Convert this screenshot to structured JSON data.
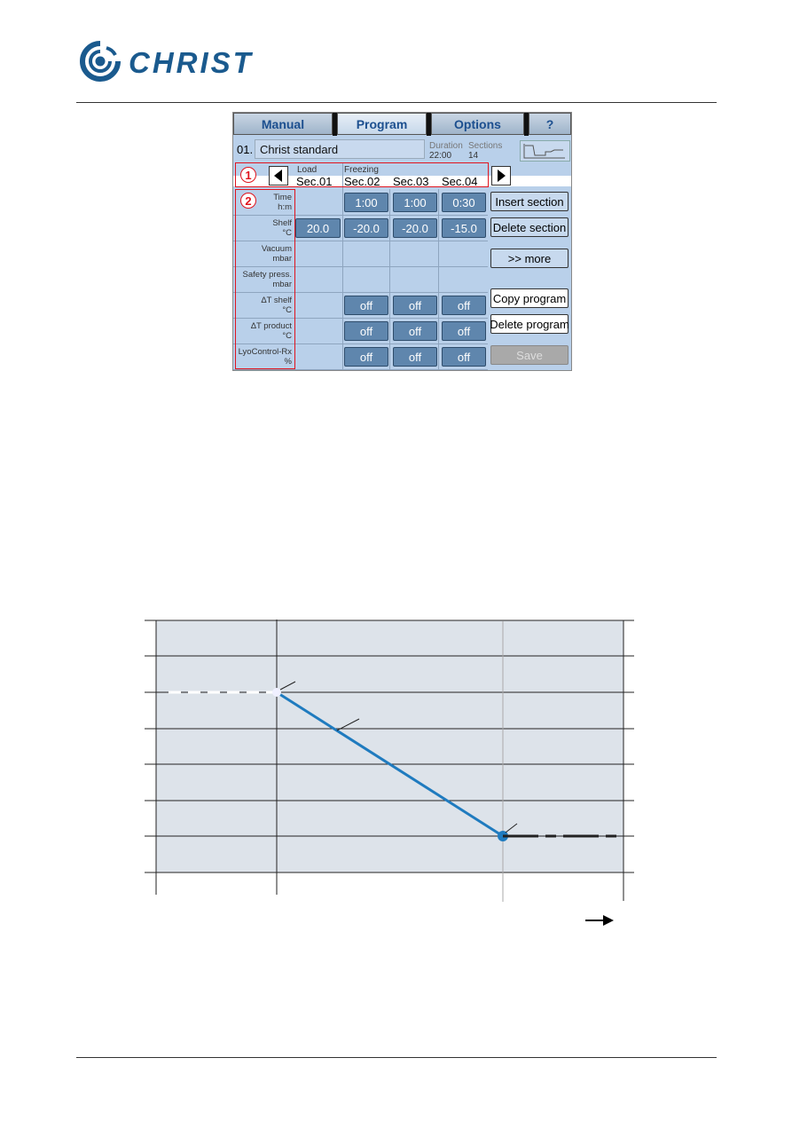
{
  "header": {
    "brand": "CHRIST",
    "brand_color": "#1a5a8e"
  },
  "ui": {
    "tabs": [
      {
        "label": "Manual"
      },
      {
        "label": "Program",
        "active": true
      },
      {
        "label": "Options"
      },
      {
        "label": "?"
      }
    ],
    "program_number": "01.",
    "program_name": "Christ standard",
    "duration_label": "Duration",
    "duration_value": "22:00",
    "sections_label": "Sections",
    "sections_value": "14",
    "callouts": [
      "1",
      "2"
    ],
    "phases": {
      "load": "Load",
      "freezing": "Freezing"
    },
    "sections": [
      "Sec.01",
      "Sec.02",
      "Sec.03",
      "Sec.04"
    ],
    "rows": [
      {
        "label": "Time",
        "unit": "h:m",
        "values": [
          "",
          "1:00",
          "1:00",
          "0:30"
        ]
      },
      {
        "label": "Shelf",
        "unit": "°C",
        "values": [
          "20.0",
          "-20.0",
          "-20.0",
          "-15.0"
        ]
      },
      {
        "label": "Vacuum",
        "unit": "mbar",
        "values": [
          "",
          "",
          "",
          ""
        ]
      },
      {
        "label": "Safety press.",
        "unit": "mbar",
        "values": [
          "",
          "",
          "",
          ""
        ]
      },
      {
        "label": "ΔT shelf",
        "unit": "°C",
        "values": [
          "",
          "off",
          "off",
          "off"
        ]
      },
      {
        "label": "ΔT product",
        "unit": "°C",
        "values": [
          "",
          "off",
          "off",
          "off"
        ]
      },
      {
        "label": "LyoControl-Rx",
        "unit": "%",
        "values": [
          "",
          "off",
          "off",
          "off"
        ]
      }
    ],
    "actions": {
      "insert": "Insert section",
      "delete": "Delete section",
      "more": ">> more",
      "copy": "Copy program",
      "delete_program": "Delete program",
      "save": "Save"
    }
  },
  "diagram": {
    "line_color": "#1f7bbf",
    "background": "#dde3ea",
    "icon": "arrow-right-icon"
  }
}
